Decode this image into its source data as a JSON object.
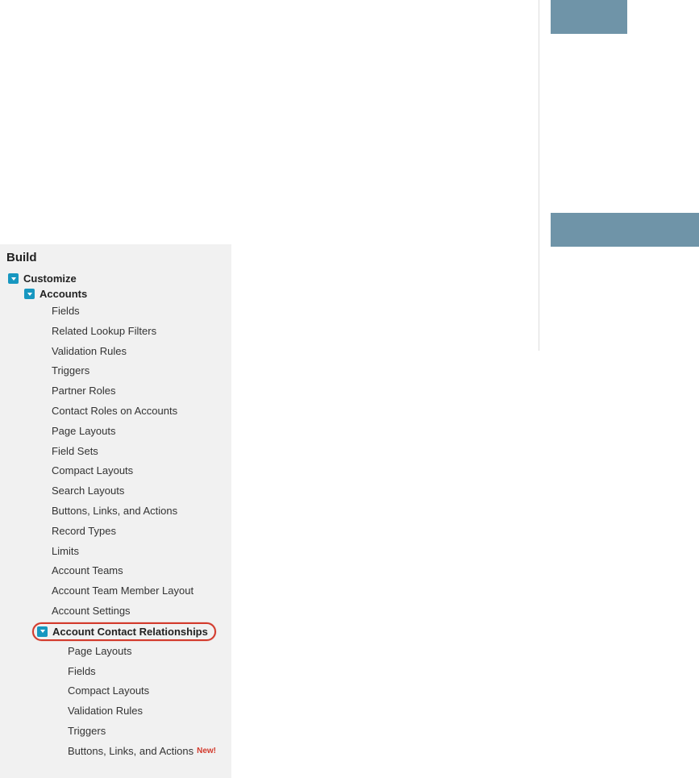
{
  "sidebar": {
    "header": "Build",
    "customize": {
      "label": "Customize",
      "accounts": {
        "label": "Accounts",
        "items": [
          "Fields",
          "Related Lookup Filters",
          "Validation Rules",
          "Triggers",
          "Partner Roles",
          "Contact Roles on Accounts",
          "Page Layouts",
          "Field Sets",
          "Compact Layouts",
          "Search Layouts",
          "Buttons, Links, and Actions",
          "Record Types",
          "Limits",
          "Account Teams",
          "Account Team Member Layout",
          "Account Settings"
        ],
        "acr": {
          "label": "Account Contact Relationships",
          "items": [
            "Page Layouts",
            "Fields",
            "Compact Layouts",
            "Validation Rules",
            "Triggers",
            "Buttons, Links, and Actions"
          ],
          "new_badge": "New!"
        }
      }
    }
  }
}
